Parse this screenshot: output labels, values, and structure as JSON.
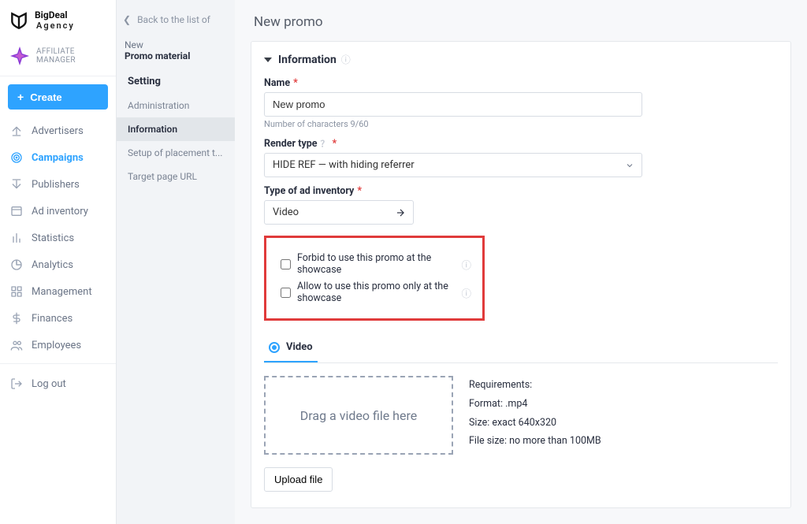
{
  "brand": {
    "line1": "BigDeal",
    "line2": "Agency"
  },
  "role": "AFFILIATE MANAGER",
  "create_label": "Create",
  "nav": {
    "items": [
      {
        "label": "Advertisers",
        "icon": "upload"
      },
      {
        "label": "Campaigns",
        "icon": "target",
        "active": true
      },
      {
        "label": "Publishers",
        "icon": "download"
      },
      {
        "label": "Ad inventory",
        "icon": "window"
      },
      {
        "label": "Statistics",
        "icon": "bars"
      },
      {
        "label": "Analytics",
        "icon": "pie"
      },
      {
        "label": "Management",
        "icon": "grid"
      },
      {
        "label": "Finances",
        "icon": "dollar"
      },
      {
        "label": "Employees",
        "icon": "users"
      }
    ],
    "logout": "Log out"
  },
  "col2": {
    "back": "Back to the list of",
    "new_label": "New",
    "new_value": "Promo material",
    "setting_heading": "Setting",
    "items": [
      {
        "label": "Administration"
      },
      {
        "label": "Information",
        "active": true
      },
      {
        "label": "Setup of placement t..."
      },
      {
        "label": "Target page URL"
      }
    ]
  },
  "page_title": "New promo",
  "section": {
    "title": "Information"
  },
  "fields": {
    "name": {
      "label": "Name",
      "value": "New promo",
      "hint": "Number of characters 9/60"
    },
    "render": {
      "label": "Render type",
      "value": "HIDE REF — with hiding referrer"
    },
    "adinv": {
      "label": "Type of ad inventory",
      "value": "Video"
    }
  },
  "checks": {
    "forbid": "Forbid to use this promo at the showcase",
    "allow": "Allow to use this promo only at the showcase"
  },
  "tab_video": "Video",
  "dropzone": "Drag a video file here",
  "requirements": {
    "title": "Requirements:",
    "format": "Format: .mp4",
    "size": "Size: exact 640x320",
    "filesize": "File size: no more than 100MB"
  },
  "upload_label": "Upload file"
}
